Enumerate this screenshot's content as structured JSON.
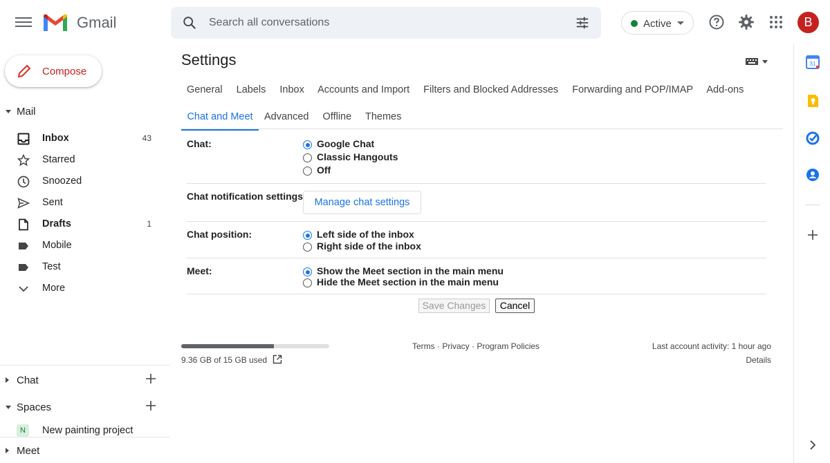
{
  "app": {
    "brand": "Gmail"
  },
  "search": {
    "placeholder": "Search all conversations"
  },
  "status": {
    "label": "Active",
    "color": "#188038"
  },
  "account": {
    "initial": "B",
    "color": "#c5221f"
  },
  "compose": {
    "label": "Compose"
  },
  "sidebar": {
    "mail_label": "Mail",
    "items": [
      {
        "label": "Inbox",
        "count": "43",
        "icon": "inbox-icon",
        "bold": true
      },
      {
        "label": "Starred",
        "count": "",
        "icon": "star-icon"
      },
      {
        "label": "Snoozed",
        "count": "",
        "icon": "clock-icon"
      },
      {
        "label": "Sent",
        "count": "",
        "icon": "send-icon"
      },
      {
        "label": "Drafts",
        "count": "1",
        "icon": "draft-icon",
        "bold": true
      },
      {
        "label": "Mobile",
        "count": "",
        "icon": "label-icon"
      },
      {
        "label": "Test",
        "count": "",
        "icon": "label-icon"
      },
      {
        "label": "More",
        "count": "",
        "icon": "chevron-down-icon"
      }
    ],
    "chat_label": "Chat",
    "spaces_label": "Spaces",
    "space_item": {
      "initial": "N",
      "label": "New painting project"
    },
    "meet_label": "Meet"
  },
  "settings": {
    "title": "Settings",
    "tabs_row1": [
      "General",
      "Labels",
      "Inbox",
      "Accounts and Import",
      "Filters and Blocked Addresses",
      "Forwarding and POP/IMAP",
      "Add-ons"
    ],
    "active_tab": "Chat and Meet",
    "tabs_row2": [
      "Advanced",
      "Offline",
      "Themes"
    ],
    "chat": {
      "label": "Chat:",
      "options": [
        "Google Chat",
        "Classic Hangouts",
        "Off"
      ],
      "selected": 0
    },
    "notif": {
      "label": "Chat notification settings:",
      "button": "Manage chat settings"
    },
    "position": {
      "label": "Chat position:",
      "options": [
        "Left side of the inbox",
        "Right side of the inbox"
      ],
      "selected": 0
    },
    "meet": {
      "label": "Meet:",
      "options": [
        "Show the Meet section in the main menu",
        "Hide the Meet section in the main menu"
      ],
      "selected": 0
    },
    "save_label": "Save Changes",
    "cancel_label": "Cancel"
  },
  "footer": {
    "storage_text": "9.36 GB of 15 GB used",
    "storage_fraction": 0.624,
    "links": "Terms · Privacy · Program Policies",
    "activity": "Last account activity: 1 hour ago",
    "details": "Details"
  },
  "rightbar": {
    "icons": [
      "calendar-icon",
      "keep-icon",
      "tasks-icon",
      "contacts-icon",
      "add-icon",
      "chevron-right-icon"
    ],
    "calendar_day": "31"
  }
}
